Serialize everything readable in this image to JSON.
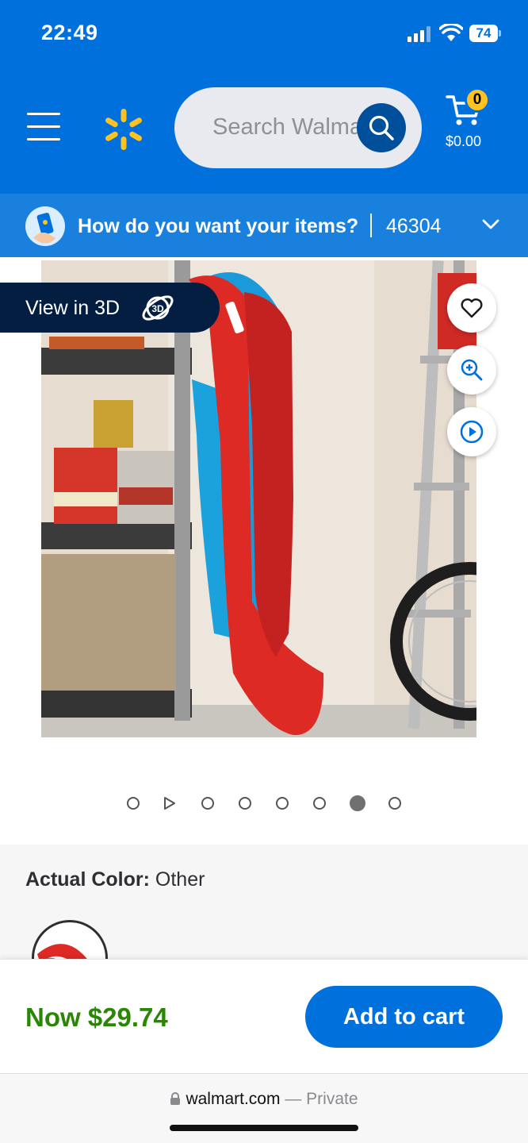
{
  "status": {
    "time": "22:49",
    "battery": "74"
  },
  "header": {
    "search_placeholder": "Search Walmart",
    "cart_count": "0",
    "cart_total": "$0.00"
  },
  "fulfillment": {
    "question": "How do you want your items?",
    "zip": "46304"
  },
  "gallery": {
    "view3d_label": "View in 3D",
    "view3d_icon_text": "3D",
    "dots": [
      "image",
      "video",
      "image",
      "image",
      "image",
      "image",
      "image",
      "image"
    ],
    "active_index": 6
  },
  "color": {
    "label": "Actual Color:",
    "value": "Other"
  },
  "buy": {
    "price": "Now $29.74",
    "add_to_cart": "Add to cart"
  },
  "browser": {
    "domain": "walmart.com",
    "mode": "— Private"
  },
  "colors": {
    "brand_blue": "#0071dc",
    "spark_yellow": "#ffc220",
    "price_green": "#2a8703",
    "navy": "#041e42"
  }
}
